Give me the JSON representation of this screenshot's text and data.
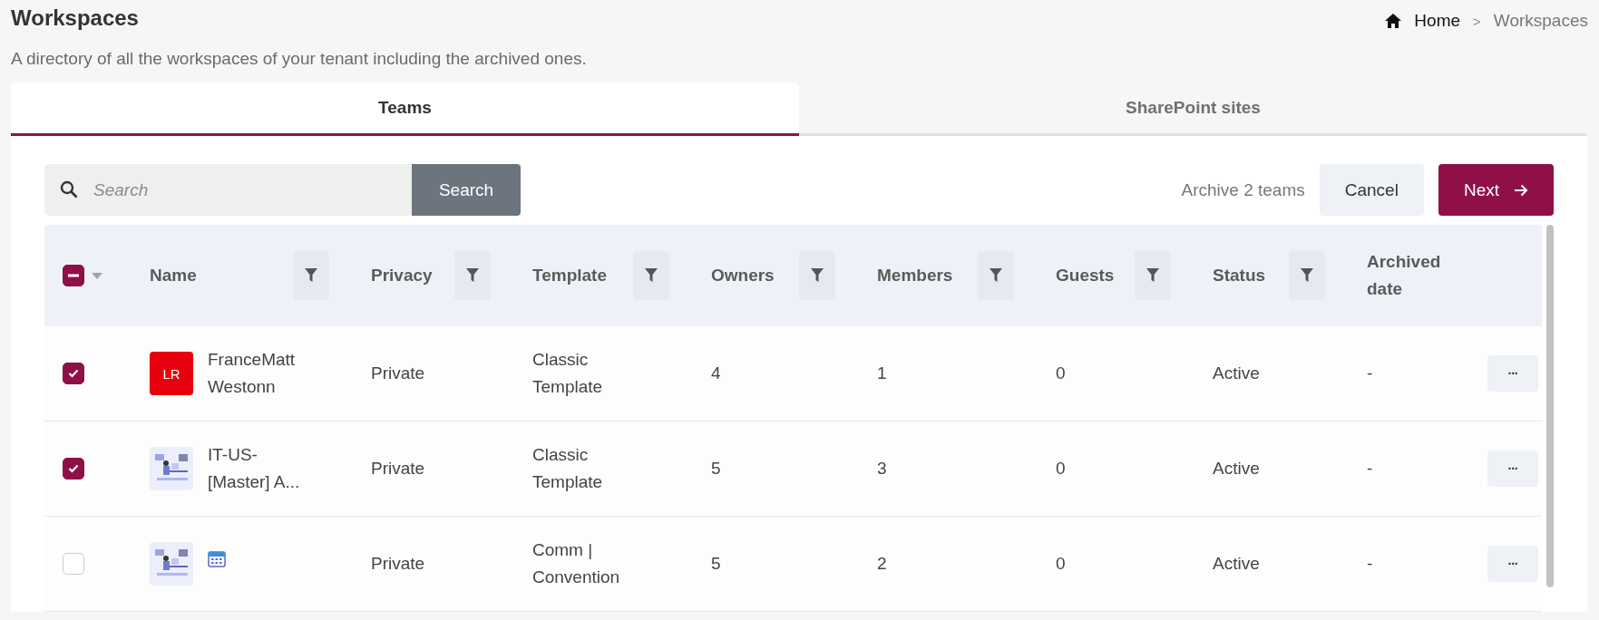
{
  "page": {
    "title": "Workspaces",
    "description": "A directory of all the workspaces of your tenant including the archived ones."
  },
  "breadcrumb": [
    {
      "label": "Home",
      "current": false
    },
    {
      "label": "Workspaces",
      "current": true
    }
  ],
  "breadcrumb_separator": ">",
  "tabs": [
    {
      "label": "Teams",
      "selected": true
    },
    {
      "label": "SharePoint sites",
      "selected": false
    }
  ],
  "search": {
    "placeholder": "Search",
    "button": "Search"
  },
  "selection_summary": "Archive 2 teams",
  "buttons": [
    {
      "label": "Cancel",
      "kind": "secondary"
    },
    {
      "label": "Next",
      "kind": "primary"
    }
  ],
  "table": {
    "select_all": {
      "indeterminate": true
    },
    "columns": [
      {
        "label": "Name",
        "filter": true
      },
      {
        "label": "Privacy",
        "filter": true
      },
      {
        "label": "Template",
        "filter": true
      },
      {
        "label": "Owners",
        "filter": true
      },
      {
        "label": "Members",
        "filter": true
      },
      {
        "label": "Guests",
        "filter": true
      },
      {
        "label": "Status",
        "filter": true
      },
      {
        "label": "Archived date",
        "filter": false
      }
    ],
    "rows": [
      {
        "selected": true,
        "avatar": {
          "kind": "initials",
          "text": "LR",
          "color": "#e8000f"
        },
        "calendar": false,
        "name": "FranceMatt Westonn",
        "privacy": "Private",
        "template": "Classic Template",
        "owners": "4",
        "members": "1",
        "guests": "0",
        "status": "Active",
        "archived_date": "-",
        "menu": "···"
      },
      {
        "selected": true,
        "avatar": {
          "kind": "picture"
        },
        "calendar": false,
        "name": "IT-US-[Master] A...",
        "privacy": "Private",
        "template": "Classic Template",
        "owners": "5",
        "members": "3",
        "guests": "0",
        "status": "Active",
        "archived_date": "-",
        "menu": "···"
      },
      {
        "selected": false,
        "avatar": {
          "kind": "picture"
        },
        "calendar": true,
        "privacy": "Private",
        "template": "Comm | Convention",
        "owners": "5",
        "members": "2",
        "guests": "0",
        "status": "Active",
        "archived_date": "-",
        "menu": "···"
      }
    ]
  }
}
